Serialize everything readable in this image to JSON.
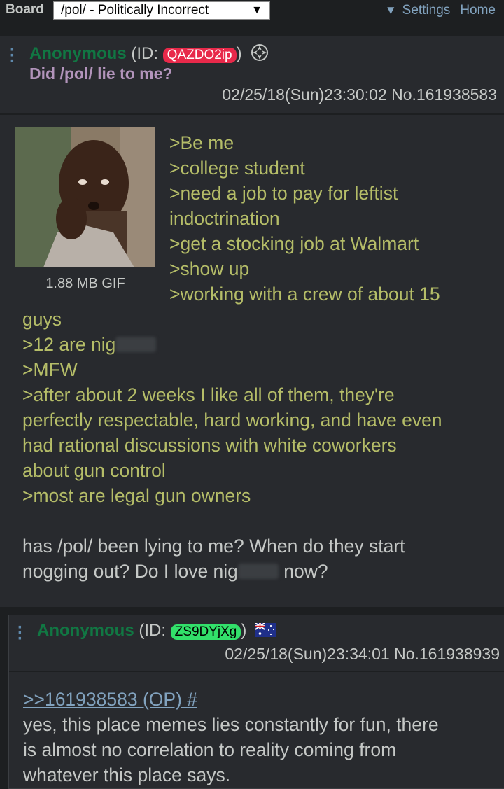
{
  "topbar": {
    "board_label": "Board",
    "board_select_value": "/pol/ - Politically Incorrect",
    "settings_label": "Settings",
    "home_label": "Home"
  },
  "op": {
    "name": "Anonymous",
    "id_prefix": "(ID: ",
    "id": "QAZDO2ip",
    "id_suffix": ")",
    "id_color": "#e8294a",
    "subject": "Did /pol/ lie to me?",
    "datetime": "02/25/18(Sun)23:30:02",
    "post_no": "No.161938583",
    "file_info": "1.88 MB GIF",
    "lines": {
      "l1": ">Be me",
      "l2": ">college student",
      "l3": ">need a job to pay for leftist",
      "l4": "indoctrination",
      "l5": ">get a stocking job at Walmart",
      "l6": ">show up",
      "l7": ">working with a crew of about 15",
      "l8": "guys",
      "l9": ">12 are nig",
      "l10": ">MFW",
      "l11": ">after about 2 weeks I like all of them, they're",
      "l12": "perfectly respectable, hard working, and have even",
      "l13": "had rational discussions with white coworkers",
      "l14": "about gun control",
      "l15": ">most are legal gun owners",
      "l16": "has /pol/ been lying to me? When do they start",
      "l17a": "nogging out? Do I love nig",
      "l17b": " now?"
    }
  },
  "reply": {
    "name": "Anonymous",
    "id_prefix": "(ID: ",
    "id": "ZS9DYjXg",
    "id_suffix": ")",
    "id_color": "#32e06a",
    "datetime": "02/25/18(Sun)23:34:01",
    "post_no": "No.161938939",
    "quote": ">>161938583 (OP) #",
    "lines": {
      "l1": "yes, this place memes lies constantly for fun, there",
      "l2": "is almost no correlation to reality coming from",
      "l3": "whatever this place says."
    }
  }
}
